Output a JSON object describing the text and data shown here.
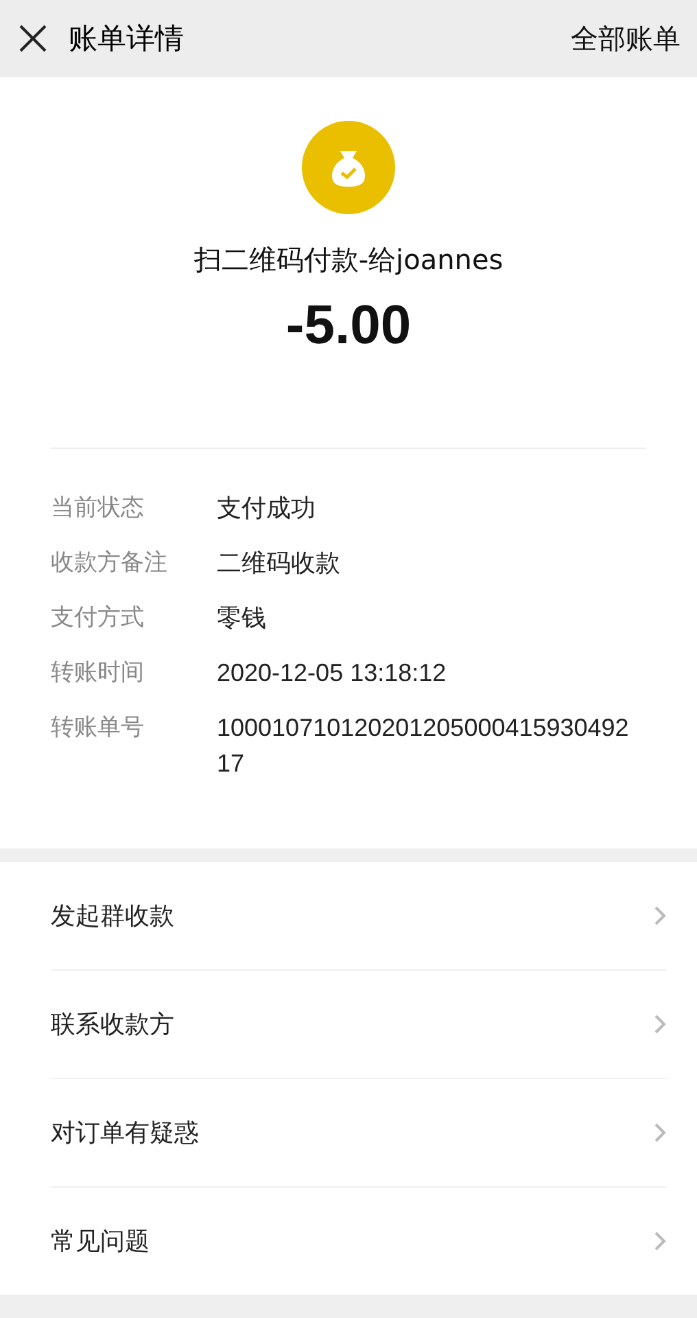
{
  "header": {
    "title": "账单详情",
    "action": "全部账单"
  },
  "summary": {
    "title": "扫二维码付款-给joannes",
    "amount": "-5.00"
  },
  "details": [
    {
      "label": "当前状态",
      "value": "支付成功"
    },
    {
      "label": "收款方备注",
      "value": "二维码收款"
    },
    {
      "label": "支付方式",
      "value": "零钱"
    },
    {
      "label": "转账时间",
      "value": "2020-12-05 13:18:12"
    },
    {
      "label": "转账单号",
      "value": "10001071012020120500041593049217"
    }
  ],
  "menu": [
    {
      "label": "发起群收款"
    },
    {
      "label": "联系收款方"
    },
    {
      "label": "对订单有疑惑"
    },
    {
      "label": "常见问题"
    }
  ]
}
